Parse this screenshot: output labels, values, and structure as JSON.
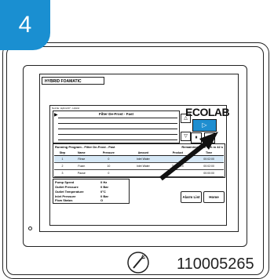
{
  "step": {
    "number": "4"
  },
  "window": {
    "title": "HYBRID FOAMATIC"
  },
  "screen": {
    "small_header": "Nozzle: Hybrid 07 - Hybrid",
    "brand": "ECOLAB",
    "program_box": {
      "title": "Filter De-Frost - Fast"
    },
    "nav": {
      "up": "△",
      "down": "▽",
      "start": "▷",
      "pause": "⏸",
      "stop": "□"
    },
    "run": {
      "title": "Running Program - Filter De-Frost - Fast",
      "remaining": "Remaining Time - 7h m 42 s",
      "columns": [
        "Step",
        "Name",
        "Pressure",
        "Amount",
        "Product",
        "Time"
      ],
      "rows": [
        [
          "1",
          "Rinse",
          "0",
          "Inlet Water",
          "",
          "00:02:00"
        ],
        [
          "2",
          "Foam",
          "10",
          "Inlet Water",
          "Topax XX",
          "00:02:00"
        ],
        [
          "3",
          "Pause",
          "0",
          "",
          "",
          "00:00:00"
        ]
      ]
    },
    "status": [
      {
        "label": "Pump Speed",
        "value": "0 Hz"
      },
      {
        "label": "Outlet Pressure",
        "value": "0 Bar"
      },
      {
        "label": "Outlet Temperature",
        "value": "0°C"
      },
      {
        "label": "Inlet Pressure",
        "value": "0 Bar"
      },
      {
        "label": "Flow Status",
        "value": "O"
      }
    ],
    "buttons": {
      "alarm_list": "Alarm List",
      "home": "Home"
    }
  },
  "footer": {
    "part_number": "110005265"
  },
  "colors": {
    "accent": "#1f8ed0",
    "badge": "#1a8fd1"
  }
}
